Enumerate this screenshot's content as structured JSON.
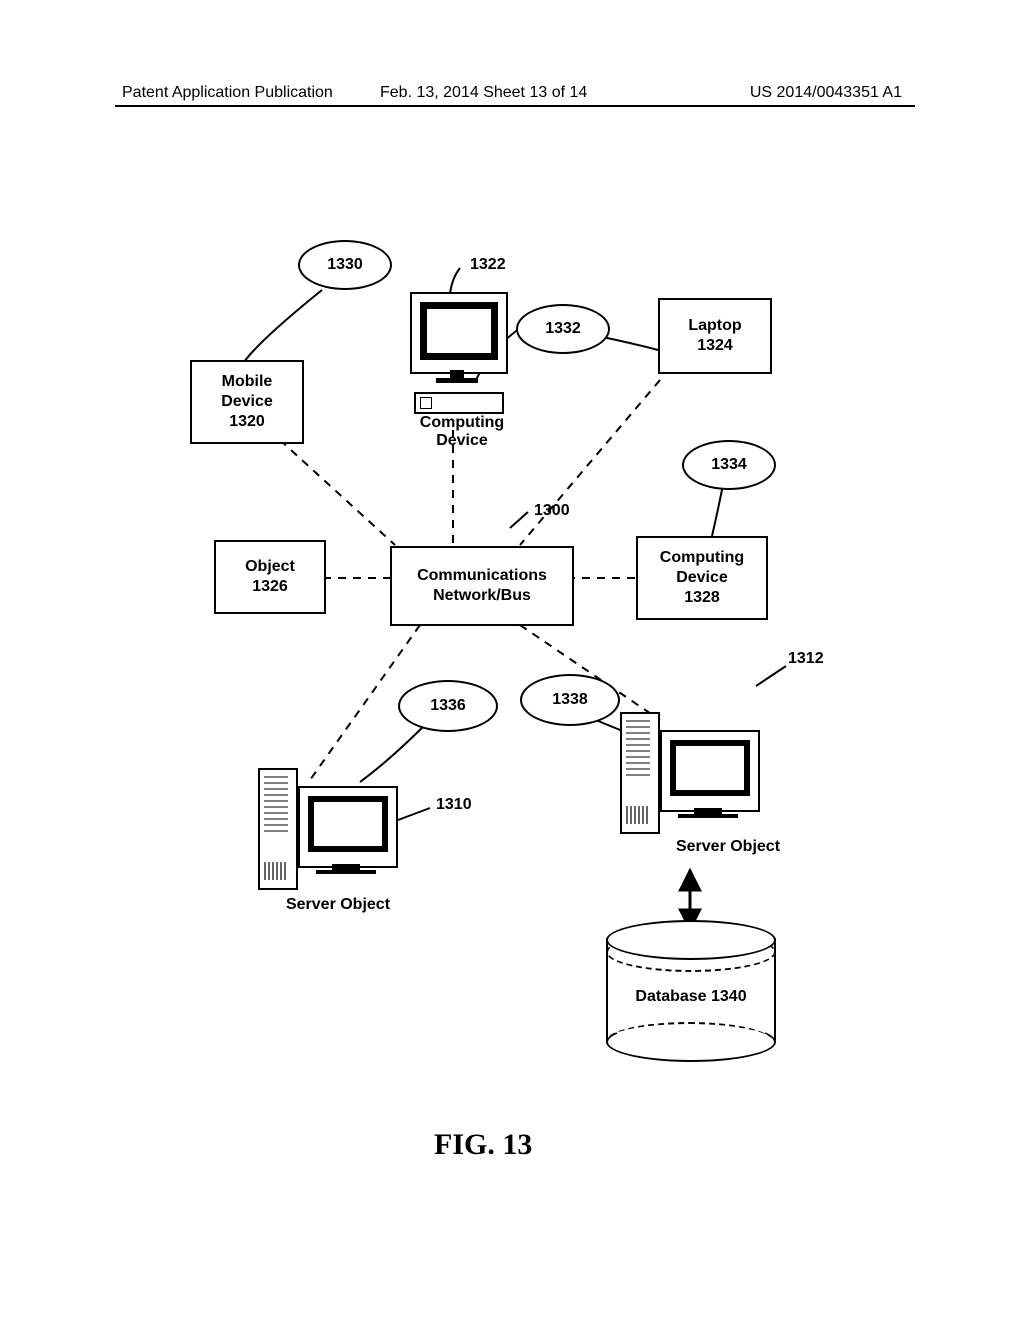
{
  "header": {
    "left": "Patent Application Publication",
    "mid": "Feb. 13, 2014  Sheet 13 of 14",
    "right": "US 2014/0043351 A1"
  },
  "nodes": {
    "mobile_device": "Mobile\nDevice\n1320",
    "object": "Object\n1326",
    "laptop": "Laptop\n1324",
    "computing_device_right": "Computing\nDevice\n1328",
    "network_bus": "Communications\nNetwork/Bus",
    "computing_device_label": "Computing Device",
    "server_object_left": "Server Object",
    "server_object_right": "Server Object",
    "database": "Database 1340"
  },
  "ellipses": {
    "e1330": "1330",
    "e1332": "1332",
    "e1334": "1334",
    "e1336": "1336",
    "e1338": "1338"
  },
  "leaders": {
    "l1322": "1322",
    "l1300": "1300",
    "l1310": "1310",
    "l1312": "1312"
  },
  "figure_label": "FIG. 13"
}
